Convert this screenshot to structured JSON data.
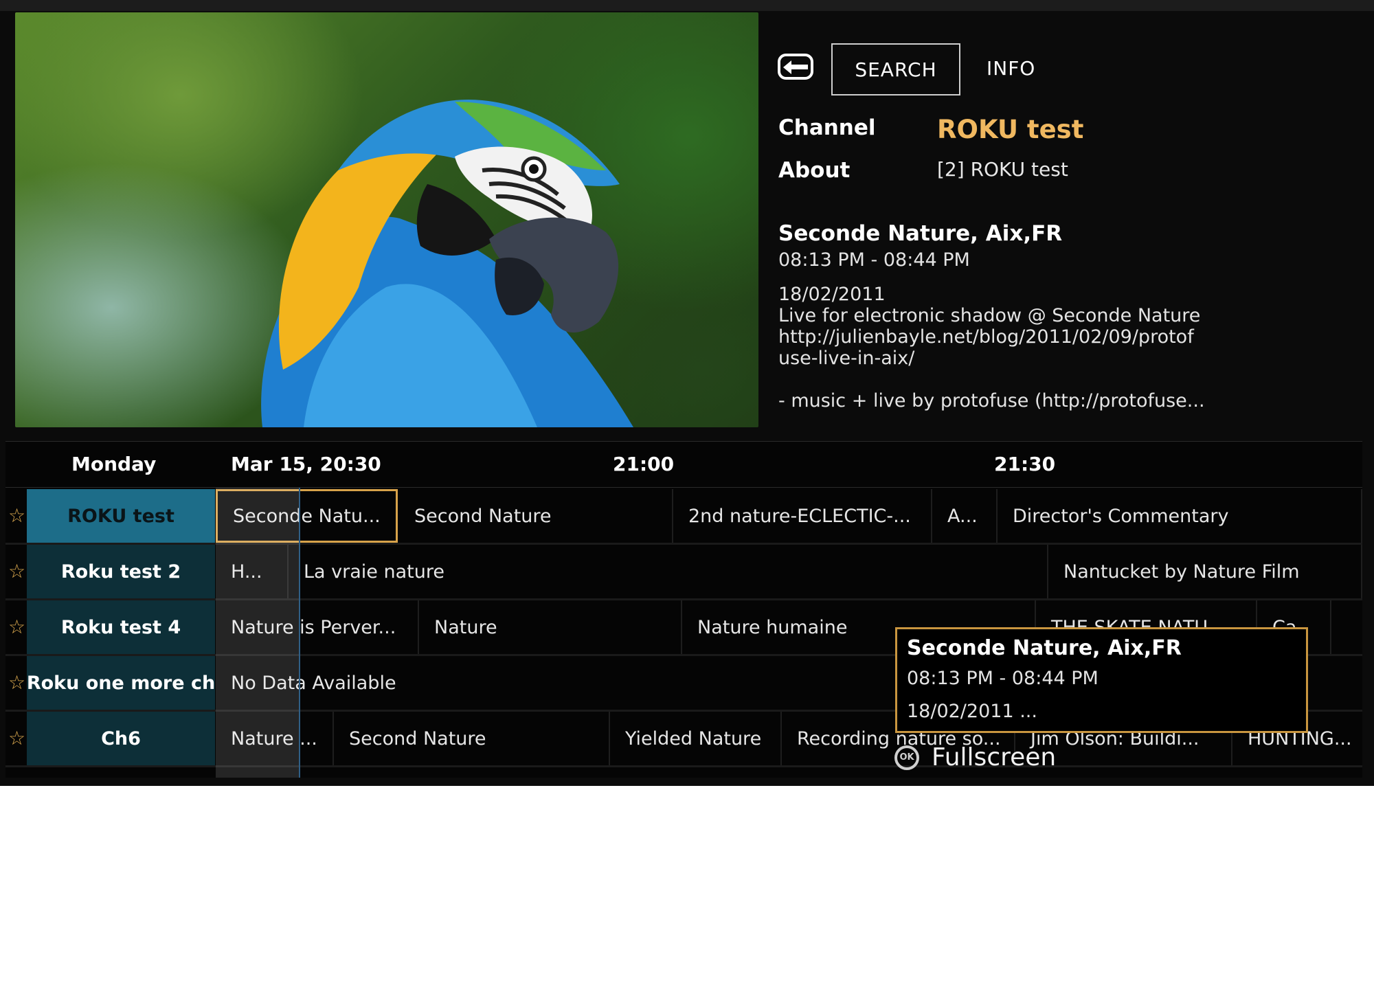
{
  "toolbar": {
    "search_label": "SEARCH",
    "info_label": "INFO"
  },
  "details": {
    "channel_label": "Channel",
    "channel_value": "ROKU test",
    "about_label": "About",
    "about_value": "[2] ROKU test",
    "program_title": "Seconde Nature, Aix,FR",
    "program_time": "08:13 PM - 08:44 PM",
    "program_description": "18/02/2011\nLive for electronic shadow @ Seconde Nature\nhttp://julienbayle.net/blog/2011/02/09/protof\nuse-live-in-aix/\n\n- music + live by protofuse (http://protofuse..."
  },
  "guide": {
    "day": "Monday",
    "times": [
      "Mar 15, 20:30",
      "21:00",
      "21:30"
    ],
    "rows": [
      {
        "channel": "ROKU test",
        "programs": [
          "Seconde Natu...",
          "Second Nature",
          "2nd nature-ECLECTIC-...",
          "A...",
          "Director's Commentary"
        ]
      },
      {
        "channel": "Roku test 2",
        "programs": [
          "H...",
          "La vraie nature",
          "Nantucket by Nature Film"
        ]
      },
      {
        "channel": "Roku test 4",
        "programs": [
          "Nature is Perver...",
          "Nature",
          "Nature humaine",
          "THE SKATE NATU...",
          "Ca"
        ]
      },
      {
        "channel": "Roku one more ch",
        "programs": [
          "No Data Available"
        ]
      },
      {
        "channel": "Ch6",
        "programs": [
          "Nature ...",
          "Second Nature",
          "Yielded Nature",
          "Recording nature so...",
          "Jim Olson: Buildi...",
          "HUNTING..."
        ]
      }
    ]
  },
  "popup": {
    "title": "Seconde Nature, Aix,FR",
    "time": "08:13 PM - 08:44 PM",
    "desc": "18/02/2011 ..."
  },
  "hint": {
    "button": "OK",
    "label": "Fullscreen"
  },
  "colors": {
    "accent": "#f0b860",
    "focus_border": "#d7a24a",
    "selected_channel": "#1d6d89",
    "channel_bg": "#0d2f38"
  }
}
